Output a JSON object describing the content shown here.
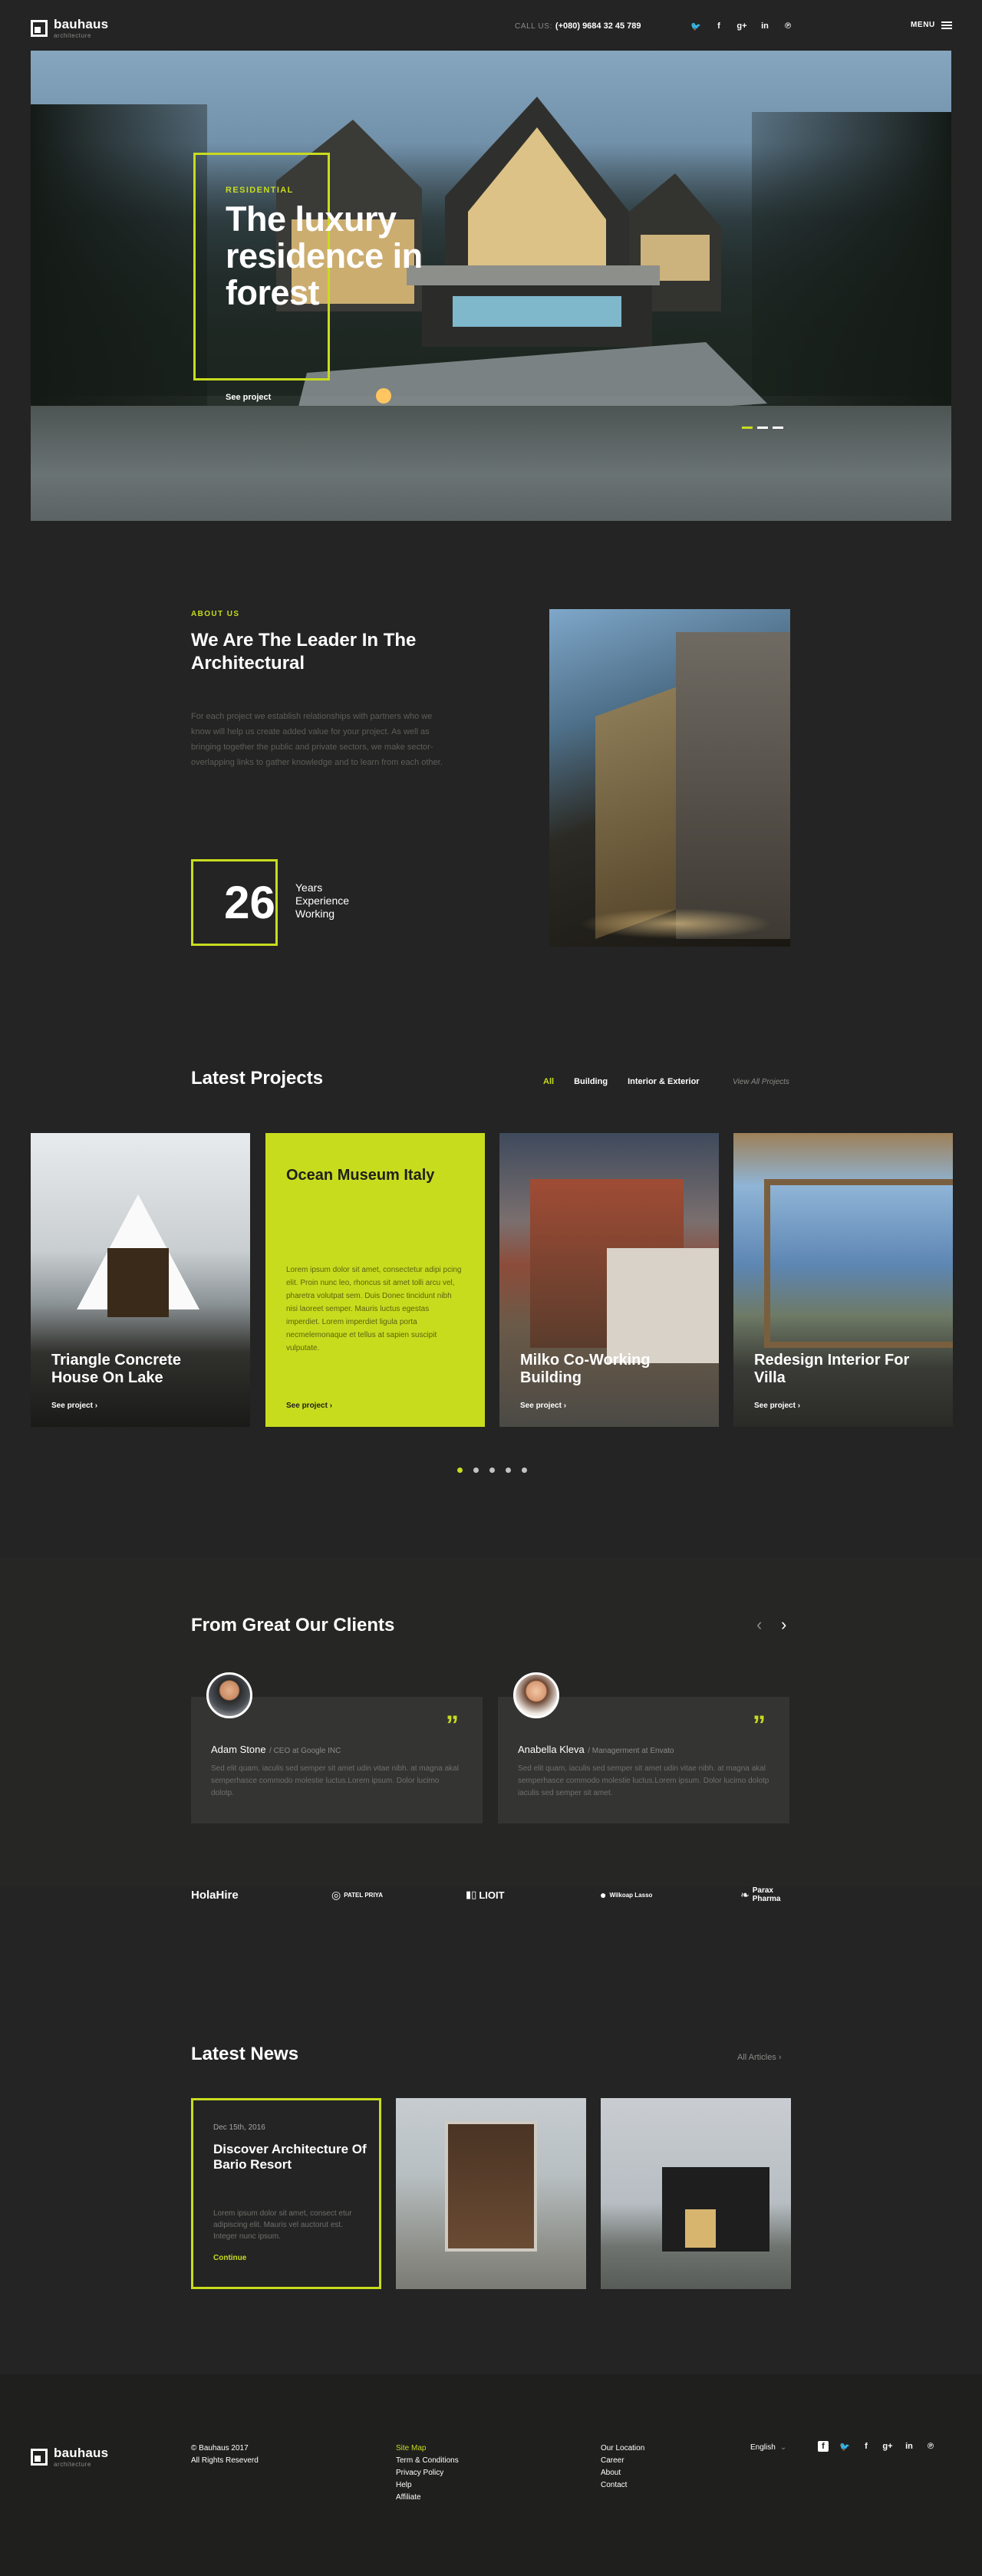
{
  "header": {
    "logo": "bauhaus",
    "logo_sub": "architecture",
    "call_label": "CALL US:",
    "phone": "(+080) 9684 32 45 789",
    "menu_label": "MENU"
  },
  "hero": {
    "label": "RESIDENTIAL",
    "title": "The luxury residence in forest",
    "cta": "See project"
  },
  "about": {
    "label": "ABOUT US",
    "title": "We Are The Leader In The Architectural",
    "text": "For each project we establish relationships with partners who we know will help us create added value for your project. As well as bringing together the public and private sectors, we make sector-overlapping links to gather knowledge and to learn from each other.",
    "years": "26",
    "years_caption": "Years Experience Working"
  },
  "projects": {
    "title": "Latest Projects",
    "filters": [
      "All",
      "Building",
      "Interior & Exterior"
    ],
    "view_all": "View All Projects",
    "cards": [
      {
        "title": "Triangle Concrete House On Lake",
        "cta": "See project"
      },
      {
        "title": "Ocean Museum Italy",
        "body": "Lorem ipsum dolor sit amet, consectetur adipi pcing elit. Proin nunc leo, rhoncus sit amet tolli arcu vel, pharetra volutpat sem. Duis Donec tincidunt nibh nisi laoreet semper. Mauris luctus egestas imperdiet. Lorem imperdiet ligula porta necmelemonaque et tellus at sapien suscipit vulputate.",
        "cta": "See project"
      },
      {
        "title": "Milko Co-Working Building",
        "cta": "See project"
      },
      {
        "title": "Redesign Interior For Villa",
        "cta": "See project"
      }
    ]
  },
  "clients": {
    "title": "From Great Our Clients",
    "testimonials": [
      {
        "name": "Adam Stone",
        "role": "CEO at Google INC",
        "text": "Sed elit quam, iaculis sed semper sit amet udin vitae nibh. at magna akal semperhasce commodo molestie luctus.Lorem ipsum. Dolor lucimo dolotp."
      },
      {
        "name": "Anabella Kleva",
        "role": "Managerment at Envato",
        "text": "Sed elit quam, iaculis sed semper sit amet udin vitae nibh. at magna akal semperhasce commodo molestie luctus.Lorem ipsum. Dolor lucimo dolotp iaculis sed semper sit amet."
      }
    ],
    "brands": [
      "HolaHire",
      "PATEL PRIYA",
      "LIOIT",
      "Wilkoap Lasso",
      "Parax Pharma"
    ]
  },
  "news": {
    "title": "Latest News",
    "all_link": "All Articles",
    "item": {
      "date": "Dec 15th, 2016",
      "title": "Discover Architecture Of Bario Resort",
      "text": "Lorem ipsum dolor sit amet, consect etur adipiscing elit. Mauris vel auctorut est. Integer nunc ipsum.",
      "cta": "Continue"
    }
  },
  "footer": {
    "logo": "bauhaus",
    "logo_sub": "architecture",
    "copyright": "© Bauhaus 2017",
    "rights": "All Rights Reseverd",
    "col1": [
      "Site Map",
      "Term & Conditions",
      "Privacy Policy",
      "Help",
      "Affiliate"
    ],
    "col2": [
      "Our Location",
      "Career",
      "About",
      "Contact"
    ],
    "language": "English"
  },
  "colors": {
    "accent": "#c8dc1e",
    "background": "#232423",
    "card": "#343532"
  }
}
